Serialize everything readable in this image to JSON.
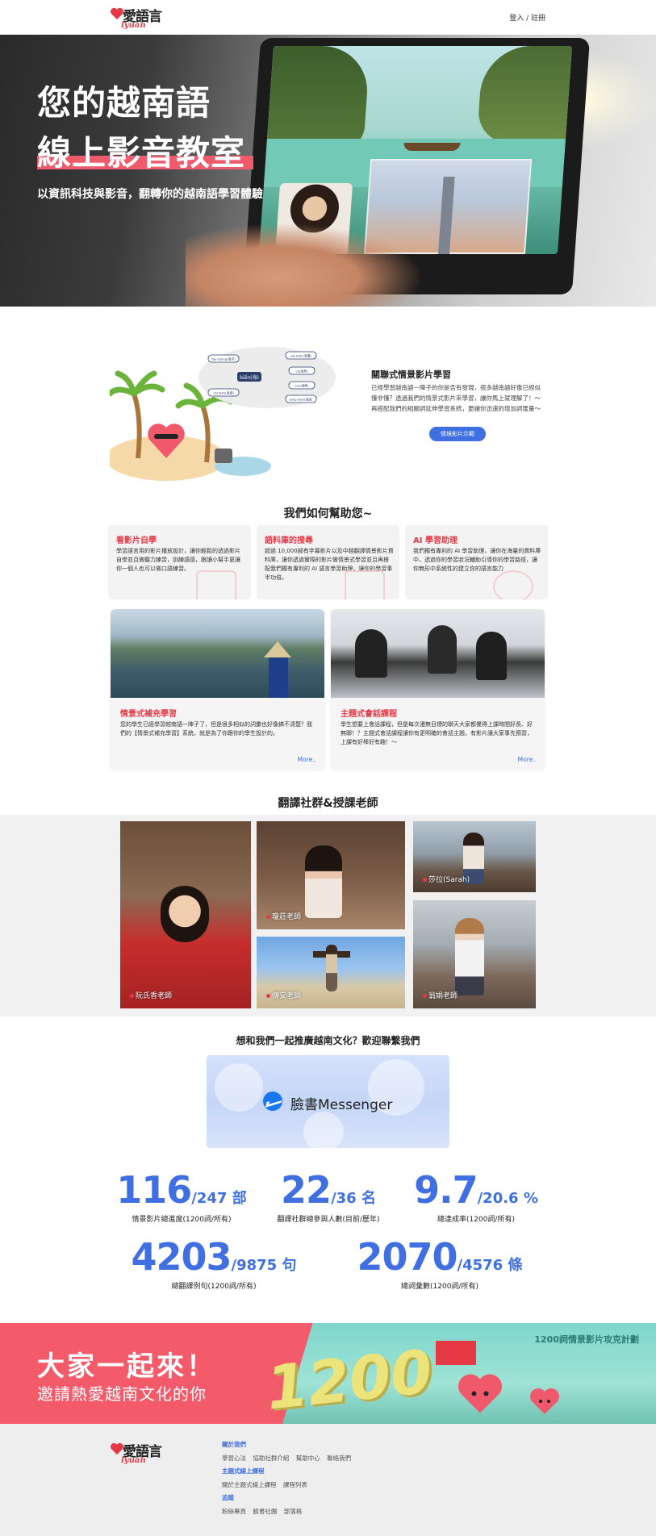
{
  "nav": {
    "logo_zh": "愛語言",
    "logo_en": "iyuan",
    "login": "登入 / 註冊"
  },
  "hero": {
    "title_line1": "您的越南語",
    "title_line2": "線上影音教室",
    "subtitle": "以資訊科技與影音，翻轉你的越南語學習體驗"
  },
  "feature": {
    "mindmap": {
      "center": "biến(海)",
      "nodes": [
        "đại dương(海洋)",
        "cõi biến(海域)",
        "bãi biến(海灘)",
        "sóng biến(海浪)",
        "cá(海魚)",
        "sơn(海鮮)"
      ]
    },
    "title": "關聯式情景影片學習",
    "desc": "已經學習越南語一陣子的你是否有發現，很多越南語好像已經似懂非懂？透過我們的情景式影片來學習，讓你馬上就理解了！～再搭配我們的相關詞延伸學習系統，更讓你迅速的增加詞匯量～",
    "button": "情境影片示範"
  },
  "help": {
    "heading": "我們如何幫助您~",
    "cards": [
      {
        "title": "看影片自學",
        "desc": "學習語言用的影片播放設計，讓你輕鬆的透過影片自學並且做聽力練習，訓練語感，跟讀小幫手更讓你一個人也可以做口語練習。"
      },
      {
        "title": "語料庫的搜尋",
        "desc": "超過 10,000部有字幕影片以及中越翻譯情景影片資料庫，讓你透過實際的影片做情景式學習並且再搭配我們獨有專利的 AI 語言學習助理，讓你的學習事半功倍。"
      },
      {
        "title": "AI 學習助理",
        "desc": "我們獨有專利的 AI 學習助理，讓你在海量的資料庫中，透過你的學習狀況輔助引導你的學習路徑，讓你無形中系統性的建立你的語言能力"
      }
    ],
    "photo_cards": [
      {
        "title": "情景式補充學習",
        "desc": "您的學生已經學習越南語一陣子了，但是很多相似的詞彙也好像搞不清楚？我們的【情景式補充學習】系統，就是為了你跟你的學生設計的。",
        "more": "More.."
      },
      {
        "title": "主題式會話課程",
        "desc": "學生想要上會話課程，但是每次漫無目標的聊天大家都覺得上課時間好長、好無聊！？主題式會話課程讓你有更明確的會話主題，有影片讓大家事先預習，上課有好棒好有趣！～",
        "more": "More.."
      }
    ]
  },
  "community": {
    "heading": "翻譯社群&授課老師",
    "teachers": [
      "阮氏香老師",
      "瓊莊老師",
      "莎拉(Sarah)",
      "傳安老師",
      "翁娟老師"
    ]
  },
  "contact": {
    "heading": "想和我們一起推廣越南文化？歡迎聯繫我們",
    "messenger": "臉書Messenger"
  },
  "stats": [
    {
      "value": "116",
      "total": "/247 部",
      "label": "情景影片總進度(1200詞/所有)"
    },
    {
      "value": "22",
      "total": "/36 名",
      "label": "翻譯社群總參與人數(目前/歷年)"
    },
    {
      "value": "9.7",
      "total": "/20.6 %",
      "label": "總達成率(1200詞/所有)"
    },
    {
      "value": "4203",
      "total": "/9875 句",
      "label": "總翻譯例句(1200詞/所有)"
    },
    {
      "value": "2070",
      "total": "/4576 條",
      "label": "總詞彙數(1200詞/所有)"
    }
  ],
  "banner": {
    "line1": "大家一起來！",
    "line2": "邀請熱愛越南文化的你",
    "plan": "1200詞情景影片攻克計劃",
    "number": "1200"
  },
  "footer": {
    "sections": [
      {
        "head": "關於我們",
        "links": [
          "學習心法",
          "協助社群介紹",
          "幫助中心",
          "聯絡我們"
        ]
      },
      {
        "head": "主題式線上課程",
        "links": [
          "關於主題式線上課程",
          "課程列表"
        ]
      },
      {
        "head": "追蹤",
        "links": [
          "粉絲專頁",
          "臉書社團",
          "部落格"
        ]
      }
    ]
  },
  "colors": {
    "accent_red": "#e63946",
    "accent_blue": "#3f6fe0",
    "banner_pink": "#f45b6a",
    "banner_teal": "#7fd6cc"
  }
}
